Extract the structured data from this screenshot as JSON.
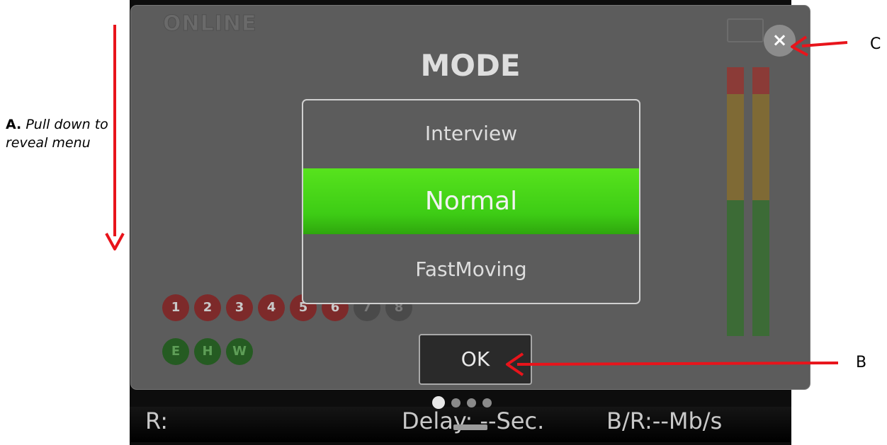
{
  "annotations": {
    "a_letter": "A.",
    "a_text": "Pull down to reveal menu",
    "b_letter": "B",
    "c_letter": "C"
  },
  "status_bar": {
    "r_label": "R:",
    "delay_text": "Delay: --Sec.",
    "bitrate_text": "B/R:--Mb/s"
  },
  "page_dots": {
    "count": 4,
    "active_index": 0
  },
  "background": {
    "status_text": "ONLINE"
  },
  "mode_dialog": {
    "title": "MODE",
    "options": [
      "Interview",
      "Normal",
      "FastMoving"
    ],
    "selected": "Normal",
    "ok_label": "OK",
    "close_label": "×"
  },
  "channels": {
    "numbers": [
      "1",
      "2",
      "3",
      "4",
      "5",
      "6",
      "7",
      "8"
    ],
    "letters": [
      "E",
      "H",
      "W"
    ]
  },
  "colors": {
    "selected": "#3dcc15",
    "arrow": "#e8141b"
  }
}
